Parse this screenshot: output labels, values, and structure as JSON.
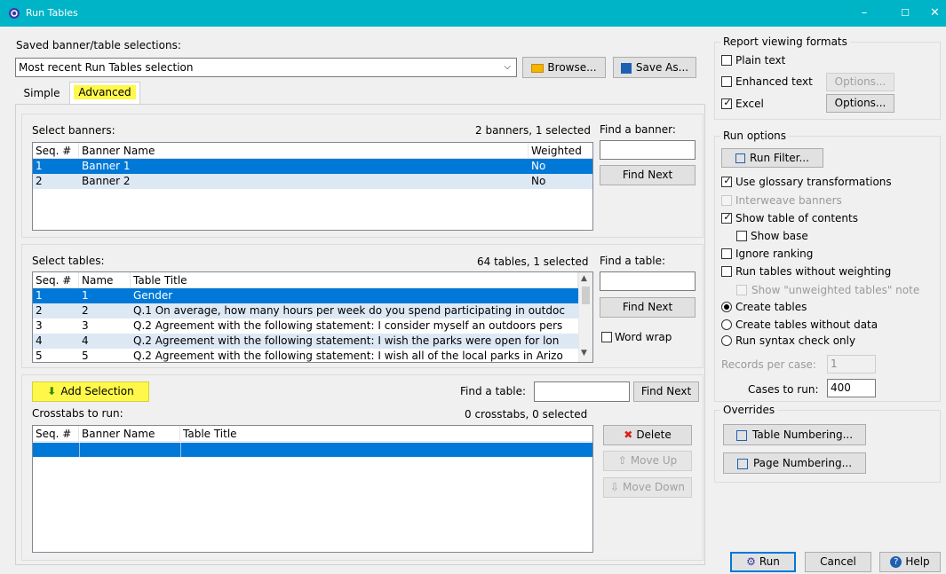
{
  "window": {
    "title": "Run Tables",
    "min": "–",
    "max": "☐",
    "close": "✕"
  },
  "saved": {
    "label": "Saved banner/table selections:",
    "value": "Most recent Run Tables selection",
    "browse": "Browse...",
    "save_as": "Save As..."
  },
  "tabs": [
    {
      "label": "Simple"
    },
    {
      "label": "Advanced"
    }
  ],
  "banners": {
    "label": "Select banners:",
    "count": "2 banners, 1 selected",
    "find_label": "Find a banner:",
    "find_value": "",
    "find_next": "Find Next",
    "columns": [
      "Seq. #",
      "Banner Name",
      "Weighted"
    ],
    "rows": [
      {
        "seq": "1",
        "name": "Banner 1",
        "weighted": "No"
      },
      {
        "seq": "2",
        "name": "Banner 2",
        "weighted": "No"
      }
    ]
  },
  "tables": {
    "label": "Select tables:",
    "count": "64 tables, 1 selected",
    "find_label": "Find a table:",
    "find_value": "",
    "find_next": "Find Next",
    "word_wrap": "Word wrap",
    "columns": [
      "Seq. #",
      "Name",
      "Table Title"
    ],
    "rows": [
      {
        "seq": "1",
        "name": "1",
        "title": "Gender"
      },
      {
        "seq": "2",
        "name": "2",
        "title": "Q.1 On average, how many hours per week do you spend participating in outdoc"
      },
      {
        "seq": "3",
        "name": "3",
        "title": "Q.2 Agreement with the following statement: I consider myself an outdoors pers"
      },
      {
        "seq": "4",
        "name": "4",
        "title": "Q.2 Agreement with the following statement: I wish the parks were open for lon"
      },
      {
        "seq": "5",
        "name": "5",
        "title": "Q.2 Agreement with the following statement: I wish all of the local parks in Arizo"
      }
    ]
  },
  "crosstabs": {
    "add_selection": "Add Selection",
    "find_label": "Find a table:",
    "find_value": "",
    "find_next": "Find Next",
    "label": "Crosstabs to run:",
    "count": "0 crosstabs, 0 selected",
    "columns": [
      "Seq. #",
      "Banner Name",
      "Table Title"
    ],
    "delete": "Delete",
    "move_up": "Move Up",
    "move_down": "Move Down"
  },
  "report_formats": {
    "title": "Report viewing formats",
    "plain_text": "Plain text",
    "enhanced_text": "Enhanced text",
    "excel": "Excel",
    "options": "Options..."
  },
  "run_options": {
    "title": "Run options",
    "run_filter": "Run Filter...",
    "use_glossary": "Use glossary transformations",
    "interweave": "Interweave banners",
    "show_toc": "Show table of contents",
    "show_base": "Show base",
    "ignore_ranking": "Ignore ranking",
    "run_without_weighting": "Run tables without weighting",
    "show_unweighted_note": "Show \"unweighted tables\" note",
    "create_tables": "Create tables",
    "create_without_data": "Create tables without data",
    "syntax_check": "Run syntax check only",
    "records_label": "Records per case:",
    "records_value": "1",
    "cases_label": "Cases to run:",
    "cases_value": "400"
  },
  "overrides": {
    "title": "Overrides",
    "table_numbering": "Table Numbering...",
    "page_numbering": "Page Numbering..."
  },
  "footer": {
    "run": "Run",
    "cancel": "Cancel",
    "help": "Help"
  },
  "colors": {
    "titlebar": "#00b4c8",
    "selection": "#0078d7",
    "highlight": "#fff84a"
  }
}
